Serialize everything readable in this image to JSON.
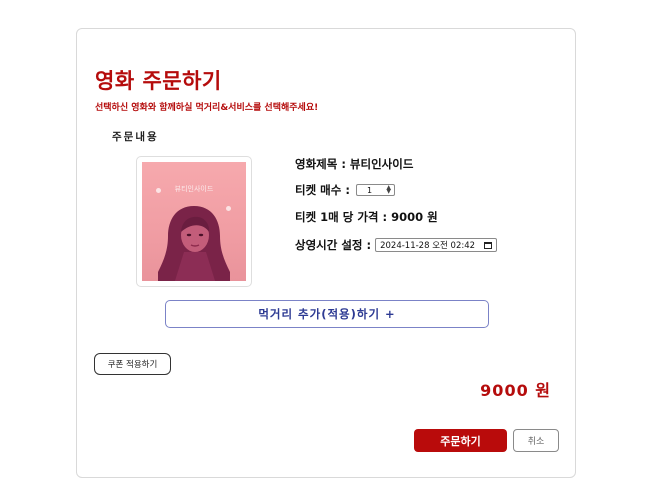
{
  "header": {
    "title": "영화 주문하기",
    "subtitle": "선택하신 영화와 함께하실 먹거리&서비스를 선택해주세요!"
  },
  "order": {
    "section_label": "주문내용",
    "movie_title_label": "영화제목 : 뷰티인사이드",
    "ticket_count_label": "티켓 매수 :",
    "ticket_count_value": "1",
    "ticket_price_label": "티켓 1매 당 가격 : 9000 원",
    "showtime_label": "상영시간 설정 :",
    "showtime_value": "2024-11-28 오전 02:42",
    "poster": {
      "title": "뷰티인사이드",
      "colors": {
        "bg": "#f3a5aa",
        "figure": "#7a2348"
      }
    }
  },
  "buttons": {
    "snack_label": "먹거리 추가(적용)하기 +",
    "coupon_label": "쿠폰 적용하기",
    "order_label": "주문하기",
    "cancel_label": "취소"
  },
  "total": {
    "price": "9000 원"
  },
  "colors": {
    "accent": "#b50c0c",
    "link_blue": "#2d3a93"
  }
}
